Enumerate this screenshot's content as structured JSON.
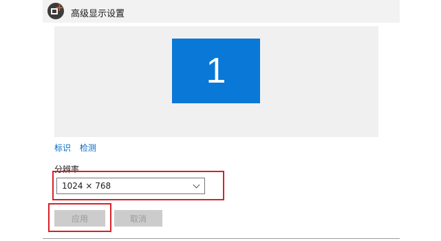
{
  "window": {
    "title": "高级显示设置",
    "icon": "display-settings-icon"
  },
  "preview": {
    "monitor_number": "1",
    "monitor_color": "#0a78d7"
  },
  "links": {
    "identify": "标识",
    "detect": "检测"
  },
  "resolution": {
    "label": "分辨率",
    "selected": "1024 × 768"
  },
  "buttons": {
    "apply": "应用",
    "cancel": "取消"
  },
  "colors": {
    "highlight": "#d81f2a",
    "link": "#0067c0"
  }
}
